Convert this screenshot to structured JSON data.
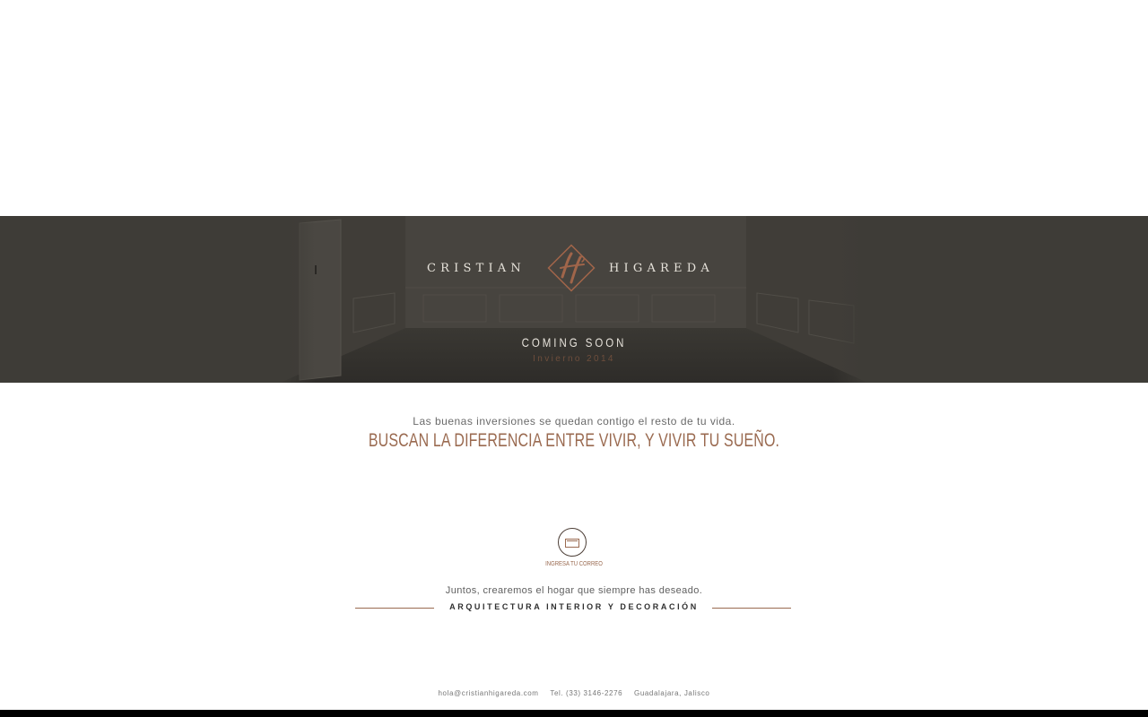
{
  "brand": {
    "name_left": "CRISTIAN",
    "name_right": "HIGAREDA"
  },
  "hero": {
    "status": "COMING SOON",
    "season": "Invierno 2014"
  },
  "tagline": {
    "lead": "Las buenas inversiones se quedan contigo el resto de tu vida.",
    "headline": "BUSCAN LA DIFERENCIA ENTRE VIVIR, Y VIVIR TU SUEÑO."
  },
  "email_cta": {
    "label": "INGRESA TU CORREO",
    "icon": "envelope-icon"
  },
  "closing": {
    "together": "Juntos, crearemos el hogar que siempre has deseado.",
    "specialty": "ARQUITECTURA INTERIOR Y DECORACIÓN"
  },
  "footer": {
    "email": "hola@cristianhigareda.com",
    "phone": "Tel. (33) 3146-2276",
    "location": "Guadalajara, Jalisco"
  },
  "colors": {
    "banner": "#3e3c37",
    "accent": "#9a6a50",
    "logo_copper": "#a0654a",
    "text_light": "#e6e2da"
  }
}
